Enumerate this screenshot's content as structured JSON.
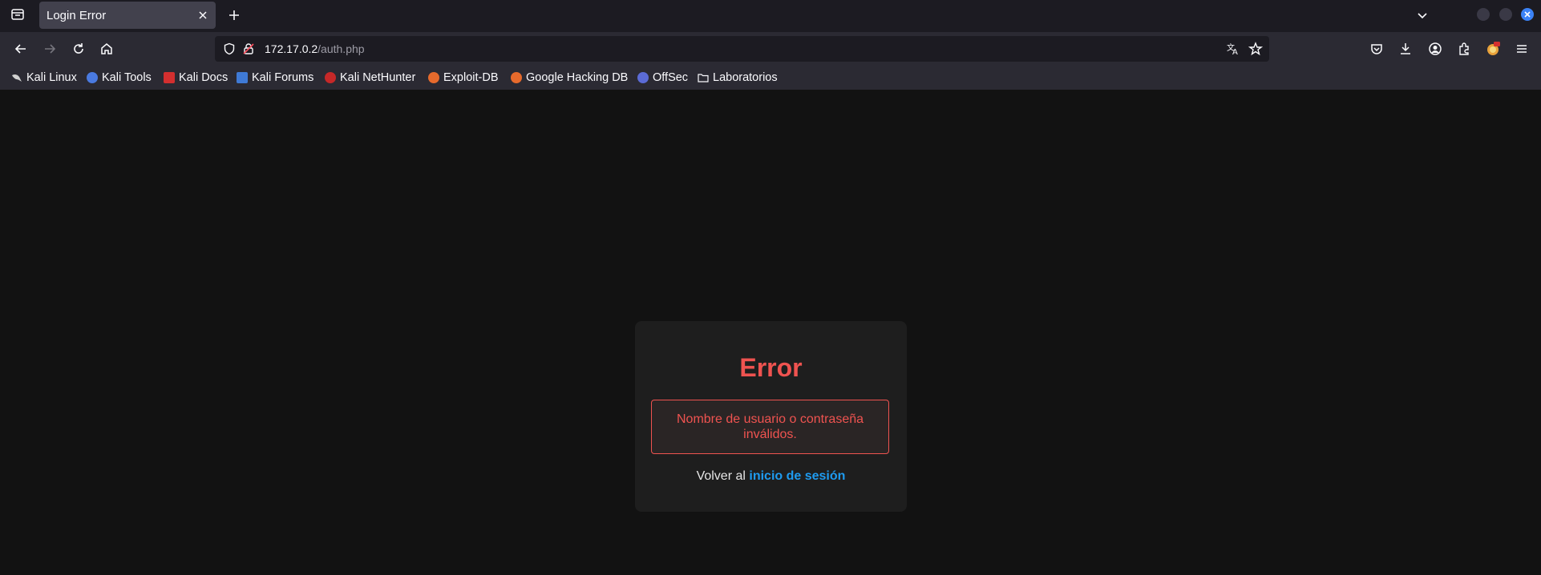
{
  "browser": {
    "tab": {
      "title": "Login Error"
    },
    "url": {
      "host": "172.17.0.2",
      "path": "/auth.php"
    },
    "bookmarks": [
      {
        "label": "Kali Linux",
        "icon": "kali-dragon-icon",
        "color": "#d0d0d0"
      },
      {
        "label": "Kali Tools",
        "icon": "kali-tools-icon",
        "color": "#4a7ae0"
      },
      {
        "label": "Kali Docs",
        "icon": "kali-docs-icon",
        "color": "#d32f2f"
      },
      {
        "label": "Kali Forums",
        "icon": "kali-forums-icon",
        "color": "#3f7ad6"
      },
      {
        "label": "Kali NetHunter",
        "icon": "kali-nethunter-icon",
        "color": "#c62828"
      },
      {
        "label": "Exploit-DB",
        "icon": "exploit-db-icon",
        "color": "#e66a2c"
      },
      {
        "label": "Google Hacking DB",
        "icon": "google-hacking-db-icon",
        "color": "#e66a2c"
      },
      {
        "label": "OffSec",
        "icon": "offsec-icon",
        "color": "#5b6bd6"
      },
      {
        "label": "Laboratorios",
        "icon": "folder-icon",
        "color": "#fbfbfe"
      }
    ]
  },
  "page": {
    "title": "Error",
    "message": "Nombre de usuario o contraseña inválidos.",
    "back_prefix": "Volver al",
    "back_link": "inicio de sesión",
    "colors": {
      "error": "#ef5350",
      "link": "#1e9bf0",
      "card": "#1e1e1e",
      "background": "#121212"
    }
  }
}
